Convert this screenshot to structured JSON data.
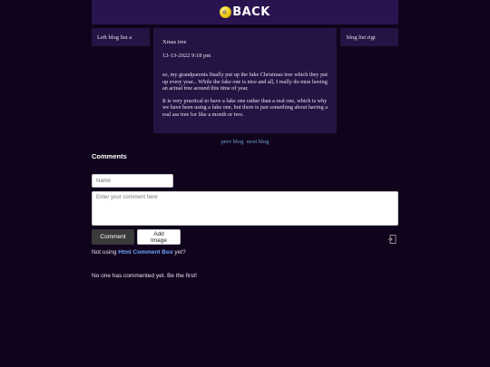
{
  "header": {
    "logo_text": "BACK"
  },
  "left_panel": {
    "label": "Left blog list a"
  },
  "right_panel": {
    "label": "blog list rigt"
  },
  "post": {
    "title": "Xmas tree",
    "date": "12-13-2022 9:18 pm",
    "paragraphs": [
      "so, my grandparents finally put up the fake Christmas tree which they put up every year... While the fake one is nice and all, I really do miss having an actual tree around this time of year.",
      "It is very practical to have a fake one rather than a real one, which is why we have been using a fake one, but there is just something about having a real ass tree for like a month or two."
    ]
  },
  "pager": {
    "prev": "prev blog",
    "next": "next blog"
  },
  "comments": {
    "title": "Comments",
    "name_placeholder": "Name",
    "comment_placeholder": "Enter your comment here",
    "comment_button": "Comment",
    "add_image_button": "Add Image",
    "note_prefix": "Not using",
    "note_link": "Html Comment Box",
    "note_suffix": "yet?",
    "empty_message": "No one has commented yet. Be the first!"
  }
}
